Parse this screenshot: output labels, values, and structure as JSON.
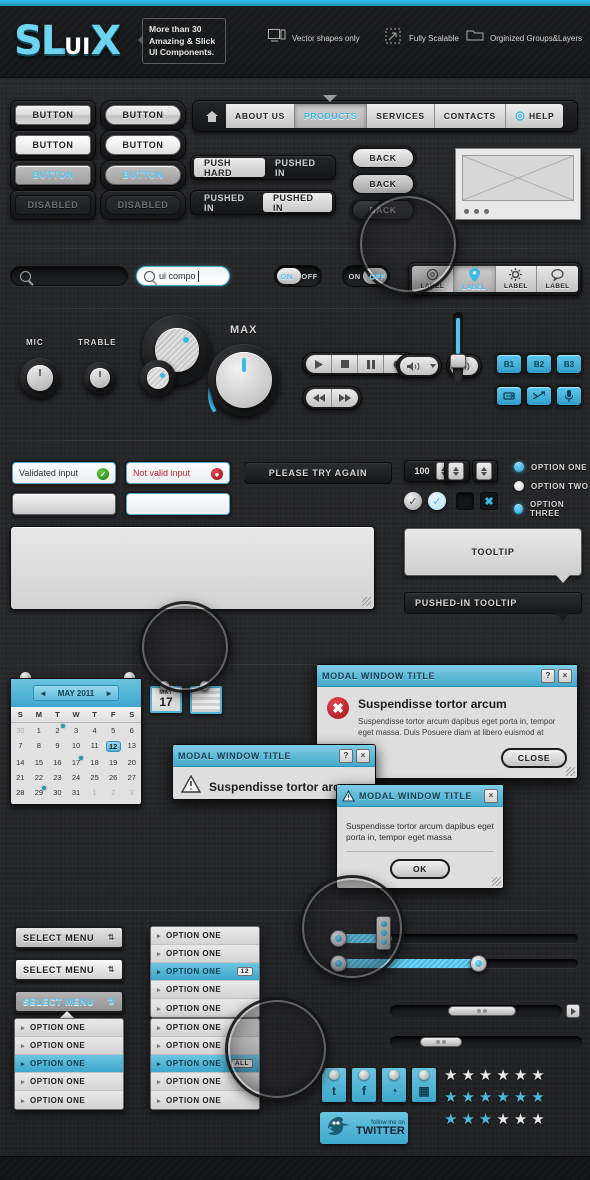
{
  "header": {
    "logo_main": "SL",
    "logo_ui": "UI",
    "logo_tail": "X",
    "tagline_l1": "More than 30",
    "tagline_l2": "Amazing & Slick",
    "tagline_l3": "UI Components.",
    "features": [
      {
        "icon": "monitor-icon",
        "label": "Vector shapes only"
      },
      {
        "icon": "scale-icon",
        "label": "Fully Scalable"
      },
      {
        "icon": "folder-icon",
        "label": "Orginized Groups&Layers"
      }
    ]
  },
  "buttons": {
    "label": "BUTTON",
    "disabled_label": "DISABLED",
    "square": [
      "BUTTON",
      "BUTTON",
      "BUTTON",
      "DISABLED"
    ],
    "rounded": [
      "BUTTON",
      "BUTTON",
      "BUTTON",
      "DISABLED"
    ]
  },
  "nav": {
    "home_icon": "home-icon",
    "items": [
      {
        "label": "ABOUT US",
        "active": false
      },
      {
        "label": "PRODUCTS",
        "active": true
      },
      {
        "label": "SERVICES",
        "active": false
      },
      {
        "label": "CONTACTS",
        "active": false
      },
      {
        "label": "HELP",
        "active": false,
        "icon": "lifebuoy-icon"
      }
    ]
  },
  "segmented": [
    {
      "left": "PUSH HARD",
      "right": "PUSHED IN",
      "active": "left"
    },
    {
      "left": "PUSHED IN",
      "right": "PUSHED IN",
      "active": "right"
    }
  ],
  "back_buttons": [
    "BACK",
    "BACK",
    "BACK"
  ],
  "label_bar": [
    {
      "icon": "lifebuoy-icon",
      "label": "LABEL",
      "active": false
    },
    {
      "icon": "pin-icon",
      "label": "LABEL",
      "active": true
    },
    {
      "icon": "gear-icon",
      "label": "LABEL",
      "active": false
    },
    {
      "icon": "speech-icon",
      "label": "LABEL",
      "active": false
    }
  ],
  "search": {
    "empty_value": "",
    "filled_value": "ui compo",
    "icon": "search-icon"
  },
  "toggles": [
    {
      "on": "ON",
      "off": "OFF",
      "state": "on"
    },
    {
      "on": "ON",
      "off": "OFF",
      "state": "off"
    }
  ],
  "knobs": {
    "mic": "MIC",
    "trable": "TRABLE",
    "max": "MAX"
  },
  "media": {
    "transport": [
      "play-icon",
      "stop-icon",
      "pause-icon",
      "record-icon"
    ],
    "seek": [
      "rewind-icon",
      "forward-icon"
    ],
    "volume_icon": "volume-icon",
    "bank": [
      "B1",
      "B2",
      "B3"
    ],
    "tools": [
      "repeat-icon",
      "shuffle-icon",
      "mic-icon"
    ]
  },
  "validation": {
    "valid_text": "Validated input",
    "invalid_text": "Not valid input",
    "error_tooltip": "PLEASE TRY AGAIN",
    "valid_icon": "check-icon",
    "invalid_icon": "error-icon"
  },
  "stepper": {
    "value": "100"
  },
  "radios": [
    {
      "label": "OPTION ONE",
      "selected": true
    },
    {
      "label": "OPTION TWO",
      "selected": false
    },
    {
      "label": "OPTION THREE",
      "selected": true
    }
  ],
  "checkboxes": [
    "check-icon",
    "check-icon",
    "empty-box",
    "x-icon"
  ],
  "tooltips": {
    "normal": "TOOLTIP",
    "pushed": "PUSHED-IN TOOLTIP"
  },
  "calendar": {
    "title": "MAY 2011",
    "prev": "◄",
    "next": "►",
    "dow": [
      "S",
      "M",
      "T",
      "W",
      "T",
      "F",
      "S"
    ],
    "weeks": [
      [
        {
          "d": "30",
          "mut": true
        },
        {
          "d": "1"
        },
        {
          "d": "2",
          "dot": true
        },
        {
          "d": "3"
        },
        {
          "d": "4"
        },
        {
          "d": "5"
        },
        {
          "d": "6"
        }
      ],
      [
        {
          "d": "7"
        },
        {
          "d": "8"
        },
        {
          "d": "9"
        },
        {
          "d": "10"
        },
        {
          "d": "11"
        },
        {
          "d": "12",
          "sel": true
        },
        {
          "d": "13"
        }
      ],
      [
        {
          "d": "14"
        },
        {
          "d": "15"
        },
        {
          "d": "16"
        },
        {
          "d": "17",
          "dot": true
        },
        {
          "d": "18"
        },
        {
          "d": "19"
        },
        {
          "d": "20"
        }
      ],
      [
        {
          "d": "21"
        },
        {
          "d": "22"
        },
        {
          "d": "23"
        },
        {
          "d": "24"
        },
        {
          "d": "25"
        },
        {
          "d": "26"
        },
        {
          "d": "27"
        }
      ],
      [
        {
          "d": "28"
        },
        {
          "d": "29",
          "dot": true
        },
        {
          "d": "30"
        },
        {
          "d": "31"
        },
        {
          "d": "1",
          "mut": true
        },
        {
          "d": "2",
          "mut": true
        },
        {
          "d": "3",
          "mut": true
        }
      ]
    ]
  },
  "date_chip": {
    "month": "MAY",
    "day": "17"
  },
  "modals": [
    {
      "title": "MODAL WINDOW TITLE",
      "help_btn": "?",
      "close_btn": "×",
      "icon": "error-icon",
      "heading": "Suspendisse tortor arcum",
      "body": "Suspendisse tortor arcum dapibus eget porta in, tempor eget massa. Duis Posuere diam at libero euismod at",
      "button": "CLOSE"
    },
    {
      "title": "MODAL WINDOW TITLE",
      "help_btn": "?",
      "close_btn": "×",
      "icon": "warning-icon",
      "heading": "Suspendisse tortor arc"
    },
    {
      "title": "MODAL WINDOW TITLE",
      "close_btn": "×",
      "icon": "warning-icon",
      "body": "Suspendisse tortor arcum dapibus eget porta in, tempor eget massa",
      "button": "OK"
    }
  ],
  "select_menus": [
    {
      "label": "SELECT MENU",
      "state": "normal"
    },
    {
      "label": "SELECT MENU",
      "state": "hover"
    },
    {
      "label": "SELECT MENU",
      "state": "active"
    }
  ],
  "option_lists": {
    "list_a": [
      {
        "label": "OPTION ONE"
      },
      {
        "label": "OPTION ONE"
      },
      {
        "label": "OPTION ONE",
        "selected": true
      },
      {
        "label": "OPTION ONE"
      },
      {
        "label": "OPTION ONE"
      }
    ],
    "list_b": [
      {
        "label": "OPTION ONE"
      },
      {
        "label": "OPTION ONE"
      },
      {
        "label": "OPTION ONE",
        "selected": true,
        "badge": "12"
      },
      {
        "label": "OPTION ONE"
      },
      {
        "label": "OPTION ONE"
      }
    ],
    "list_c": [
      {
        "label": "OPTION ONE"
      },
      {
        "label": "OPTION ONE"
      },
      {
        "label": "OPTION ONE",
        "selected": true,
        "badge": "ALL"
      },
      {
        "label": "OPTION ONE"
      },
      {
        "label": "OPTION ONE"
      }
    ]
  },
  "social": [
    {
      "icon": "twitter-icon",
      "glyph": "t"
    },
    {
      "icon": "facebook-icon",
      "glyph": "f"
    },
    {
      "icon": "rss-icon",
      "glyph": "◔"
    },
    {
      "icon": "delicious-icon",
      "glyph": "▦"
    }
  ],
  "twitter_badge": {
    "line1": "follow me on",
    "line2": "TWITTER",
    "icon": "twitter-bird-icon"
  },
  "stars": {
    "rows": [
      {
        "filled": 0,
        "total": 6,
        "color": "#e8e8e8"
      },
      {
        "filled": 6,
        "total": 6,
        "color": "#4fb8d8"
      },
      {
        "filled": 3,
        "total": 6,
        "color": "#4fb8d8"
      }
    ],
    "glyph": "★"
  },
  "colors": {
    "accent_cyan": "#4fc8ef",
    "modal_header": "#45a9cc",
    "bg_dark": "#242527",
    "error_red": "#c32026",
    "success_green": "#2f8f1f"
  }
}
